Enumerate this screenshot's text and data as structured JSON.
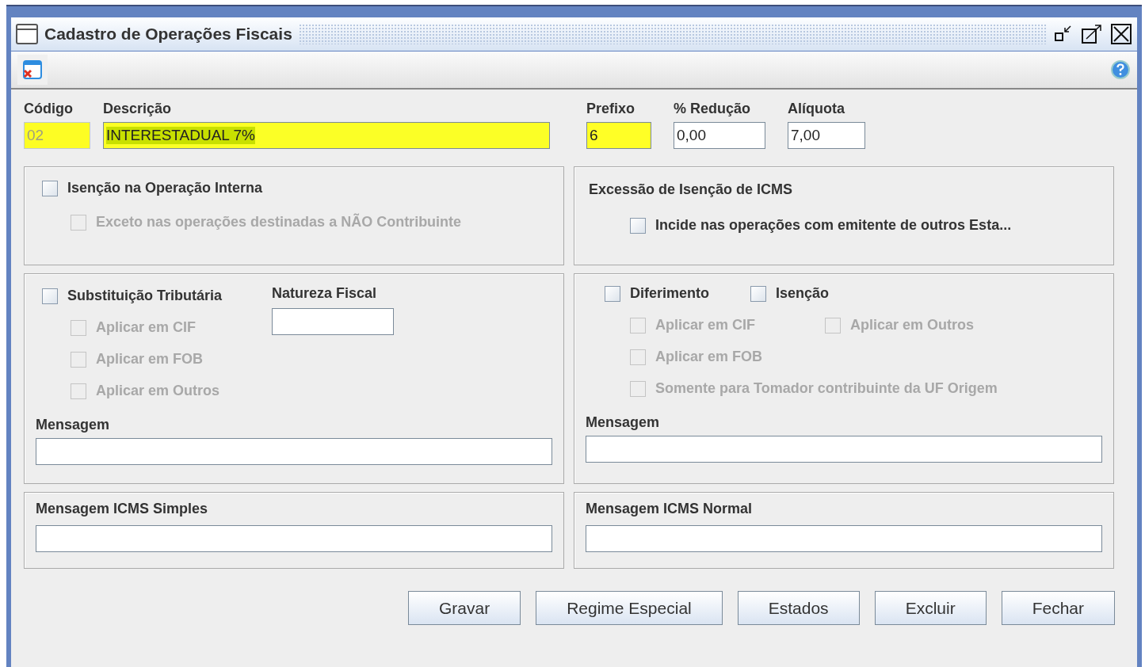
{
  "window": {
    "title": "Cadastro de Operações Fiscais"
  },
  "fields": [
    {
      "label": "Código",
      "value": "02",
      "disabled": true,
      "highlighted": true,
      "selected": false
    },
    {
      "label": "Descrição",
      "value": "INTERESTADUAL 7%",
      "disabled": false,
      "highlighted": true,
      "selected": true
    },
    {
      "label": "Prefixo",
      "value": "6",
      "disabled": false,
      "highlighted": true,
      "selected": false
    },
    {
      "label": "% Redução",
      "value": "0,00",
      "disabled": false,
      "highlighted": false,
      "selected": false
    },
    {
      "label": "Alíquota",
      "value": "7,00",
      "disabled": false,
      "highlighted": false,
      "selected": false
    }
  ],
  "isencao_interna": {
    "checkbox": {
      "label": "Isenção na Operação Interna",
      "checked": false,
      "disabled": false
    },
    "sub_checkbox": {
      "label": "Exceto nas operações destinadas a NÃO Contribuinte",
      "checked": false,
      "disabled": true
    }
  },
  "excessao": {
    "title": "Excessão de Isenção de ICMS",
    "checkbox": {
      "label": "Incide nas operações com emitente de outros Esta...",
      "checked": false,
      "disabled": false
    }
  },
  "substituicao": {
    "checkbox": {
      "label": "Substituição Tributária",
      "checked": false,
      "disabled": false
    },
    "options": [
      {
        "label": "Aplicar em CIF",
        "checked": false,
        "disabled": true
      },
      {
        "label": "Aplicar em FOB",
        "checked": false,
        "disabled": true
      },
      {
        "label": "Aplicar em Outros",
        "checked": false,
        "disabled": true
      }
    ],
    "natureza_fiscal": {
      "label": "Natureza Fiscal"
    },
    "mensagem": {
      "label": "Mensagem"
    }
  },
  "diferimento": {
    "checkboxes": [
      {
        "label": "Diferimento",
        "checked": false,
        "disabled": false
      },
      {
        "label": "Isenção",
        "checked": false,
        "disabled": false
      }
    ],
    "option_rows": [
      [
        {
          "label": "Aplicar em CIF",
          "checked": false,
          "disabled": true
        },
        {
          "label": "Aplicar em Outros",
          "checked": false,
          "disabled": true
        }
      ],
      [
        {
          "label": "Aplicar em FOB",
          "checked": false,
          "disabled": true
        }
      ],
      [
        {
          "label": "Somente para Tomador contribuinte da UF Origem",
          "checked": false,
          "disabled": true
        }
      ]
    ],
    "mensagem": {
      "label": "Mensagem"
    }
  },
  "mensagem_simples": {
    "label": "Mensagem ICMS Simples"
  },
  "mensagem_normal": {
    "label": "Mensagem ICMS Normal"
  },
  "buttons": [
    {
      "label": "Gravar"
    },
    {
      "label": "Regime Especial"
    },
    {
      "label": "Estados"
    },
    {
      "label": "Excluir"
    },
    {
      "label": "Fechar"
    }
  ]
}
